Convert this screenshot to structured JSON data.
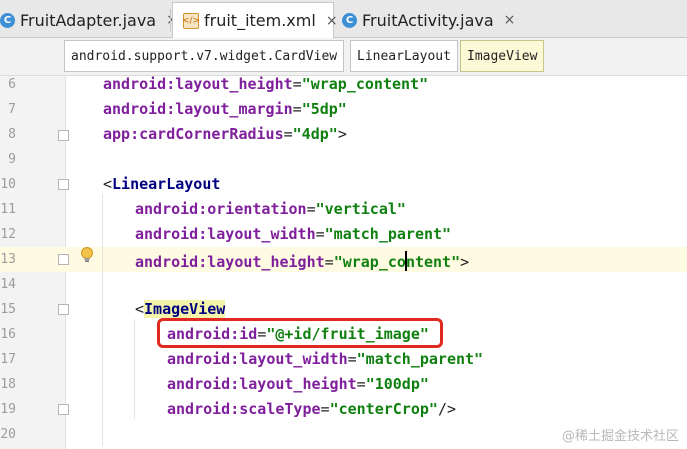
{
  "tabs": [
    {
      "label": "FruitAdapter.java",
      "icon": "java-class-icon",
      "active": false
    },
    {
      "label": "fruit_item.xml",
      "icon": "xml-file-icon",
      "active": true
    },
    {
      "label": "FruitActivity.java",
      "icon": "java-class-icon",
      "active": false
    }
  ],
  "tab_close_glyph": "×",
  "breadcrumbs": [
    "android.support.v7.widget.CardView",
    "LinearLayout",
    "ImageView"
  ],
  "line_numbers": [
    "6",
    "7",
    "8",
    "9",
    "10",
    "11",
    "12",
    "13",
    "14",
    "15",
    "16",
    "17",
    "18",
    "19",
    "20"
  ],
  "code": {
    "l6": {
      "ns": "android:",
      "attr": "layout_height",
      "eq": "=",
      "val": "\"wrap_content\""
    },
    "l7": {
      "ns": "android:",
      "attr": "layout_margin",
      "eq": "=",
      "val": "\"5dp\""
    },
    "l8": {
      "ns": "app:",
      "attr": "cardCornerRadius",
      "eq": "=",
      "val": "\"4dp\"",
      "end": ">"
    },
    "l10": {
      "open": "<",
      "tag": "LinearLayout"
    },
    "l11": {
      "ns": "android:",
      "attr": "orientation",
      "eq": "=",
      "val": "\"vertical\""
    },
    "l12": {
      "ns": "android:",
      "attr": "layout_width",
      "eq": "=",
      "val": "\"match_parent\""
    },
    "l13": {
      "ns": "android:",
      "attr": "layout_height",
      "eq": "=",
      "val_a": "\"wrap_co",
      "val_b": "ntent\"",
      "end": ">"
    },
    "l15": {
      "open": "<",
      "tag": "ImageView"
    },
    "l16": {
      "ns": "android:",
      "attr": "id",
      "eq": "=",
      "val": "\"@+id/fruit_image\""
    },
    "l17": {
      "ns": "android:",
      "attr": "layout_width",
      "eq": "=",
      "val": "\"match_parent\""
    },
    "l18": {
      "ns": "android:",
      "attr": "layout_height",
      "eq": "=",
      "val": "\"100dp\""
    },
    "l19": {
      "ns": "android:",
      "attr": "scaleType",
      "eq": "=",
      "val": "\"centerCrop\"",
      "end": "/>"
    }
  },
  "current_line": "13",
  "highlight_color": "#e02a20",
  "watermark": "@稀土掘金技术社区"
}
